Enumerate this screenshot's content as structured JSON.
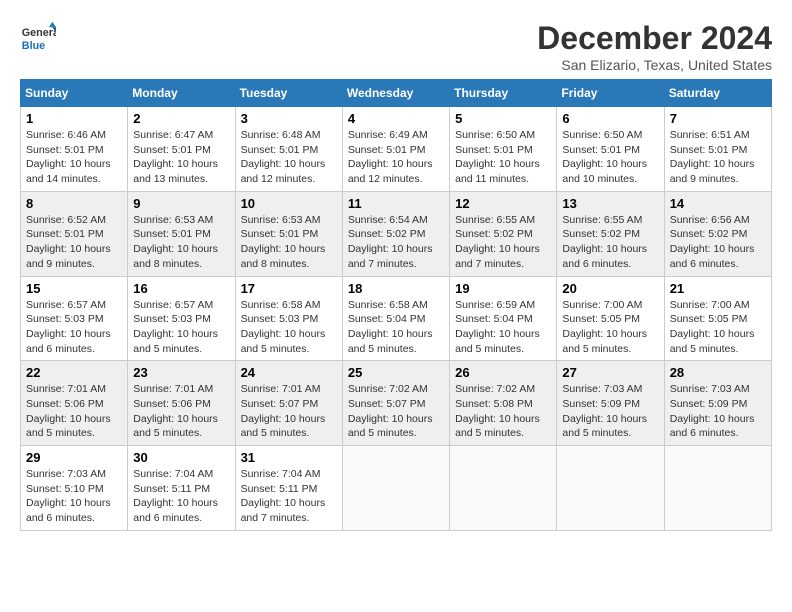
{
  "logo": {
    "general": "General",
    "blue": "Blue"
  },
  "header": {
    "month": "December 2024",
    "location": "San Elizario, Texas, United States"
  },
  "weekdays": [
    "Sunday",
    "Monday",
    "Tuesday",
    "Wednesday",
    "Thursday",
    "Friday",
    "Saturday"
  ],
  "weeks": [
    [
      {
        "day": "1",
        "sunrise": "Sunrise: 6:46 AM",
        "sunset": "Sunset: 5:01 PM",
        "daylight": "Daylight: 10 hours and 14 minutes."
      },
      {
        "day": "2",
        "sunrise": "Sunrise: 6:47 AM",
        "sunset": "Sunset: 5:01 PM",
        "daylight": "Daylight: 10 hours and 13 minutes."
      },
      {
        "day": "3",
        "sunrise": "Sunrise: 6:48 AM",
        "sunset": "Sunset: 5:01 PM",
        "daylight": "Daylight: 10 hours and 12 minutes."
      },
      {
        "day": "4",
        "sunrise": "Sunrise: 6:49 AM",
        "sunset": "Sunset: 5:01 PM",
        "daylight": "Daylight: 10 hours and 12 minutes."
      },
      {
        "day": "5",
        "sunrise": "Sunrise: 6:50 AM",
        "sunset": "Sunset: 5:01 PM",
        "daylight": "Daylight: 10 hours and 11 minutes."
      },
      {
        "day": "6",
        "sunrise": "Sunrise: 6:50 AM",
        "sunset": "Sunset: 5:01 PM",
        "daylight": "Daylight: 10 hours and 10 minutes."
      },
      {
        "day": "7",
        "sunrise": "Sunrise: 6:51 AM",
        "sunset": "Sunset: 5:01 PM",
        "daylight": "Daylight: 10 hours and 9 minutes."
      }
    ],
    [
      {
        "day": "8",
        "sunrise": "Sunrise: 6:52 AM",
        "sunset": "Sunset: 5:01 PM",
        "daylight": "Daylight: 10 hours and 9 minutes."
      },
      {
        "day": "9",
        "sunrise": "Sunrise: 6:53 AM",
        "sunset": "Sunset: 5:01 PM",
        "daylight": "Daylight: 10 hours and 8 minutes."
      },
      {
        "day": "10",
        "sunrise": "Sunrise: 6:53 AM",
        "sunset": "Sunset: 5:01 PM",
        "daylight": "Daylight: 10 hours and 8 minutes."
      },
      {
        "day": "11",
        "sunrise": "Sunrise: 6:54 AM",
        "sunset": "Sunset: 5:02 PM",
        "daylight": "Daylight: 10 hours and 7 minutes."
      },
      {
        "day": "12",
        "sunrise": "Sunrise: 6:55 AM",
        "sunset": "Sunset: 5:02 PM",
        "daylight": "Daylight: 10 hours and 7 minutes."
      },
      {
        "day": "13",
        "sunrise": "Sunrise: 6:55 AM",
        "sunset": "Sunset: 5:02 PM",
        "daylight": "Daylight: 10 hours and 6 minutes."
      },
      {
        "day": "14",
        "sunrise": "Sunrise: 6:56 AM",
        "sunset": "Sunset: 5:02 PM",
        "daylight": "Daylight: 10 hours and 6 minutes."
      }
    ],
    [
      {
        "day": "15",
        "sunrise": "Sunrise: 6:57 AM",
        "sunset": "Sunset: 5:03 PM",
        "daylight": "Daylight: 10 hours and 6 minutes."
      },
      {
        "day": "16",
        "sunrise": "Sunrise: 6:57 AM",
        "sunset": "Sunset: 5:03 PM",
        "daylight": "Daylight: 10 hours and 5 minutes."
      },
      {
        "day": "17",
        "sunrise": "Sunrise: 6:58 AM",
        "sunset": "Sunset: 5:03 PM",
        "daylight": "Daylight: 10 hours and 5 minutes."
      },
      {
        "day": "18",
        "sunrise": "Sunrise: 6:58 AM",
        "sunset": "Sunset: 5:04 PM",
        "daylight": "Daylight: 10 hours and 5 minutes."
      },
      {
        "day": "19",
        "sunrise": "Sunrise: 6:59 AM",
        "sunset": "Sunset: 5:04 PM",
        "daylight": "Daylight: 10 hours and 5 minutes."
      },
      {
        "day": "20",
        "sunrise": "Sunrise: 7:00 AM",
        "sunset": "Sunset: 5:05 PM",
        "daylight": "Daylight: 10 hours and 5 minutes."
      },
      {
        "day": "21",
        "sunrise": "Sunrise: 7:00 AM",
        "sunset": "Sunset: 5:05 PM",
        "daylight": "Daylight: 10 hours and 5 minutes."
      }
    ],
    [
      {
        "day": "22",
        "sunrise": "Sunrise: 7:01 AM",
        "sunset": "Sunset: 5:06 PM",
        "daylight": "Daylight: 10 hours and 5 minutes."
      },
      {
        "day": "23",
        "sunrise": "Sunrise: 7:01 AM",
        "sunset": "Sunset: 5:06 PM",
        "daylight": "Daylight: 10 hours and 5 minutes."
      },
      {
        "day": "24",
        "sunrise": "Sunrise: 7:01 AM",
        "sunset": "Sunset: 5:07 PM",
        "daylight": "Daylight: 10 hours and 5 minutes."
      },
      {
        "day": "25",
        "sunrise": "Sunrise: 7:02 AM",
        "sunset": "Sunset: 5:07 PM",
        "daylight": "Daylight: 10 hours and 5 minutes."
      },
      {
        "day": "26",
        "sunrise": "Sunrise: 7:02 AM",
        "sunset": "Sunset: 5:08 PM",
        "daylight": "Daylight: 10 hours and 5 minutes."
      },
      {
        "day": "27",
        "sunrise": "Sunrise: 7:03 AM",
        "sunset": "Sunset: 5:09 PM",
        "daylight": "Daylight: 10 hours and 5 minutes."
      },
      {
        "day": "28",
        "sunrise": "Sunrise: 7:03 AM",
        "sunset": "Sunset: 5:09 PM",
        "daylight": "Daylight: 10 hours and 6 minutes."
      }
    ],
    [
      {
        "day": "29",
        "sunrise": "Sunrise: 7:03 AM",
        "sunset": "Sunset: 5:10 PM",
        "daylight": "Daylight: 10 hours and 6 minutes."
      },
      {
        "day": "30",
        "sunrise": "Sunrise: 7:04 AM",
        "sunset": "Sunset: 5:11 PM",
        "daylight": "Daylight: 10 hours and 6 minutes."
      },
      {
        "day": "31",
        "sunrise": "Sunrise: 7:04 AM",
        "sunset": "Sunset: 5:11 PM",
        "daylight": "Daylight: 10 hours and 7 minutes."
      },
      null,
      null,
      null,
      null
    ]
  ]
}
